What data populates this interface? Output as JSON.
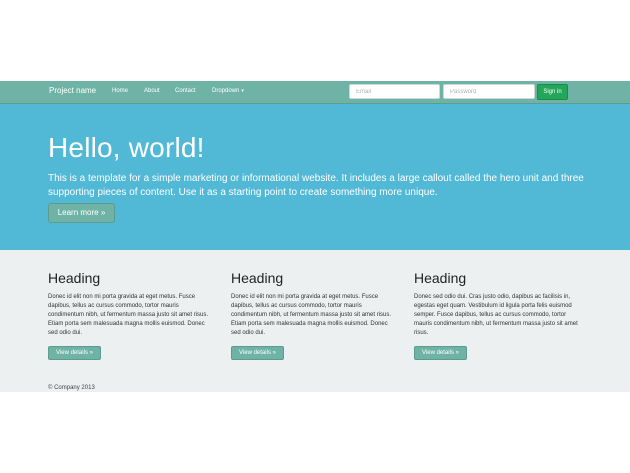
{
  "navbar": {
    "brand": "Project name",
    "items": [
      {
        "label": "Home"
      },
      {
        "label": "About"
      },
      {
        "label": "Contact"
      },
      {
        "label": "Dropdown"
      }
    ],
    "email_placeholder": "Email",
    "password_placeholder": "Password",
    "signin_label": "Sign in"
  },
  "hero": {
    "title": "Hello, world!",
    "text": "This is a template for a simple marketing or informational website. It includes a large callout called the hero unit and three supporting pieces of content. Use it as a starting point to create something more unique.",
    "button_label": "Learn more »"
  },
  "columns": [
    {
      "heading": "Heading",
      "text": "Donec id elit non mi porta gravida at eget metus. Fusce dapibus, tellus ac cursus commodo, tortor mauris condimentum nibh, ut fermentum massa justo sit amet risus. Etiam porta sem malesuada magna mollis euismod. Donec sed odio dui.",
      "button_label": "View details »"
    },
    {
      "heading": "Heading",
      "text": "Donec id elit non mi porta gravida at eget metus. Fusce dapibus, tellus ac cursus commodo, tortor mauris condimentum nibh, ut fermentum massa justo sit amet risus. Etiam porta sem malesuada magna mollis euismod. Donec sed odio dui.",
      "button_label": "View details »"
    },
    {
      "heading": "Heading",
      "text": "Donec sed odio dui. Cras justo odio, dapibus ac facilisis in, egestas eget quam. Vestibulum id ligula porta felis euismod semper. Fusce dapibus, tellus ac cursus commodo, tortor mauris condimentum nibh, ut fermentum massa justo sit amet risus.",
      "button_label": "View details »"
    }
  ],
  "footer": {
    "text": "© Company 2013"
  },
  "colors": {
    "navbar": "#6fb3a6",
    "hero": "#51b8d6",
    "body": "#ecf0f1",
    "signin": "#22a65a"
  },
  "icons": {
    "dropdown": "caret-down-icon"
  }
}
